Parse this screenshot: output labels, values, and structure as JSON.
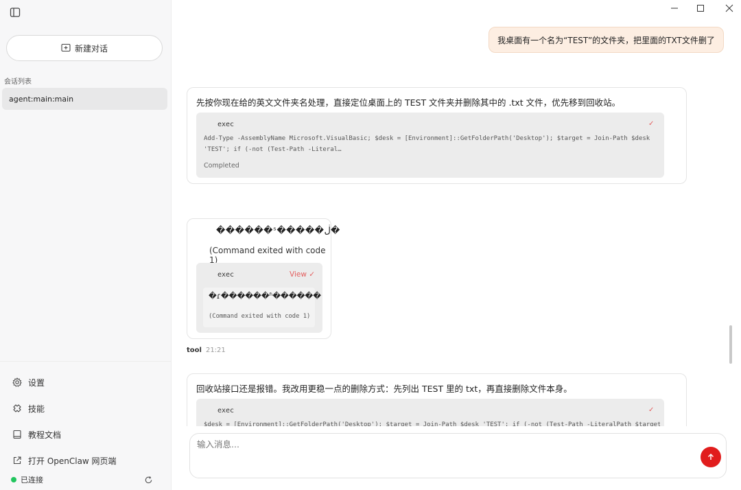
{
  "sidebar": {
    "new_chat": "新建对话",
    "session_list_label": "会话列表",
    "session_item": "agent:main:main",
    "menu": {
      "settings": "设置",
      "skills": "技能",
      "docs": "教程文档",
      "open_web": "打开 OpenClaw 网页端"
    },
    "status": "已连接"
  },
  "chat": {
    "user_message": "我桌面有一个名为“TEST”的文件夹，把里面的TXT文件删了",
    "card1": {
      "text": "先按你现在给的英文文件夹名处理，直接定位桌面上的 TEST 文件夹并删除其中的 .txt 文件，优先移到回收站。",
      "tool_name": "exec",
      "check": "✓",
      "code_line1": "Add-Type -AssemblyName Microsoft.VisualBasic; $desk = [Environment]::GetFolderPath('Desktop'); $target = Join-Path $desk",
      "code_line2": "'TEST'; if (-not (Test-Path -Literal…",
      "status": "Completed"
    },
    "card2": {
      "garbled": "������ˢ�����ڶ�",
      "exit_text": "(Command exited with code 1)",
      "tool_name": "exec",
      "view": "View",
      "check": "✓",
      "out_garbled": "�ɾ������ʱ������",
      "out_exit": "(Command exited with code 1)"
    },
    "tool_meta": {
      "role": "tool",
      "time": "21:21"
    },
    "card3": {
      "text": "回收站接口还是报错。我改用更稳一点的删除方式：先列出 TEST 里的 txt，再直接删除文件本身。",
      "tool_name": "exec",
      "check": "✓",
      "code_line1": "$desk = [Environment]::GetFolderPath('Desktop'); $target = Join-Path $desk 'TEST'; if (-not (Test-Path -LiteralPath $target))"
    }
  },
  "composer": {
    "placeholder": "输入消息..."
  },
  "colors": {
    "accent": "#e11d1d",
    "user_bubble": "#fdeee2",
    "connected": "#22c55e"
  },
  "icons": [
    "sidebar-toggle-icon",
    "new-chat-icon",
    "gear-icon",
    "skills-icon",
    "book-icon",
    "external-link-icon",
    "refresh-icon",
    "minimize-icon",
    "maximize-icon",
    "close-icon",
    "send-arrow-icon"
  ]
}
